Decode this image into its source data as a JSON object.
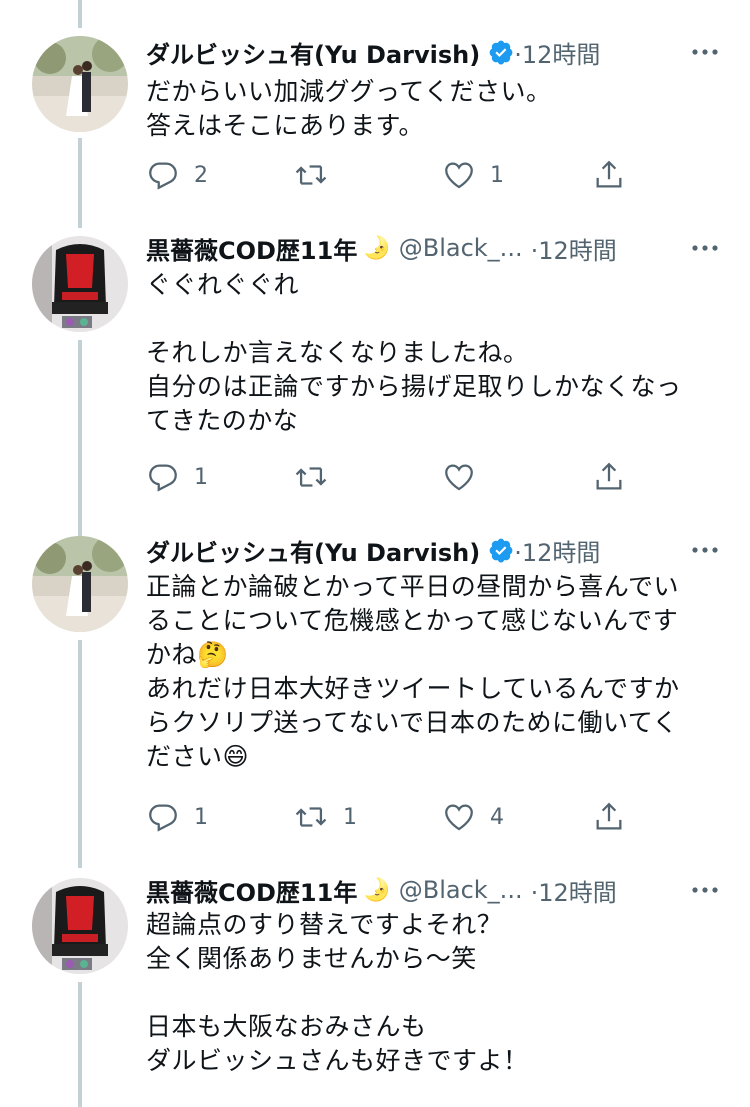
{
  "tweets": [
    {
      "author": "ダルビッシュ有(Yu Darvish)",
      "verified": true,
      "handle": "",
      "time": "·12時間",
      "lines": [
        "だからいい加減ググってください。",
        "答えはそこにあります。"
      ],
      "replies": "2",
      "retweets": "",
      "likes": "1"
    },
    {
      "author": "黒薔薇COD歴11年",
      "author_emoji": "🌛",
      "handle": "@Black_...",
      "time": "·12時間",
      "lines": [
        "ぐぐれぐぐれ",
        "",
        "それしか言えなくなりましたね。",
        "自分のは正論ですから揚げ足取りしかなくなっ",
        "てきたのかな"
      ],
      "replies": "1",
      "retweets": "",
      "likes": ""
    },
    {
      "author": "ダルビッシュ有(Yu Darvish)",
      "verified": true,
      "handle": "",
      "time": "·12時間",
      "lines": [
        "正論とか論破とかって平日の昼間から喜んでい",
        "ることについて危機感とかって感じないんです",
        "かね🤔",
        "あれだけ日本大好きツイートしているんですか",
        "らクソリプ送ってないで日本のために働いてく",
        "ださい😄"
      ],
      "replies": "1",
      "retweets": "1",
      "likes": "4"
    },
    {
      "author": "黒薔薇COD歴11年",
      "author_emoji": "🌛",
      "handle": "@Black_...",
      "time": "·12時間",
      "lines": [
        "超論点のすり替えですよそれ？",
        "全く関係ありませんから〜笑",
        "",
        "日本も大阪なおみさんも",
        "ダルビッシュさんも好きですよ！"
      ],
      "replies": "",
      "retweets": "",
      "likes": ""
    }
  ],
  "colors": {
    "verified": "#1d9bf0",
    "icon_gray": "#536471",
    "thread_line": "#c4cfd6"
  }
}
